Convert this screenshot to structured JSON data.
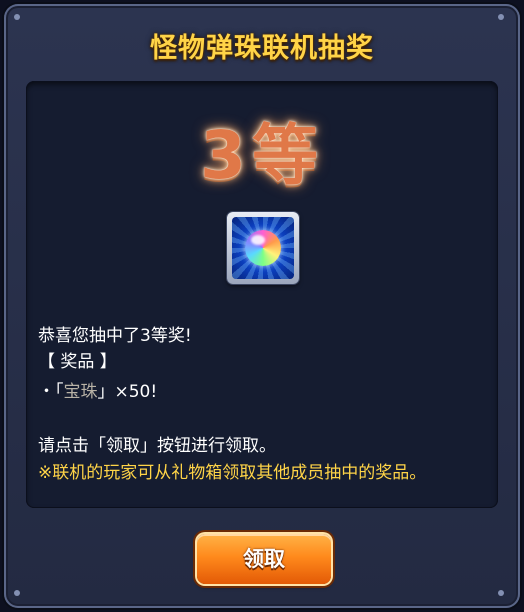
{
  "dialog": {
    "title": "怪物弹珠联机抽奖"
  },
  "result": {
    "rank": "3等",
    "prize_icon": "rainbow-orb-icon",
    "message_congrats": "恭喜您抽中了3等奖!",
    "prize_header": "【 奖品 】",
    "prize_line_prefix": "・「",
    "prize_name": "宝珠",
    "prize_line_suffix": "」×50!",
    "instruction": "请点击「领取」按钮进行领取。",
    "note": "※联机的玩家可从礼物箱领取其他成员抽中的奖品。"
  },
  "actions": {
    "claim_label": "领取"
  },
  "colors": {
    "title": "#ffd447",
    "note": "#ffd447",
    "rank": "#e07848",
    "button": "#ff8a1c",
    "panel": "#151c30"
  }
}
